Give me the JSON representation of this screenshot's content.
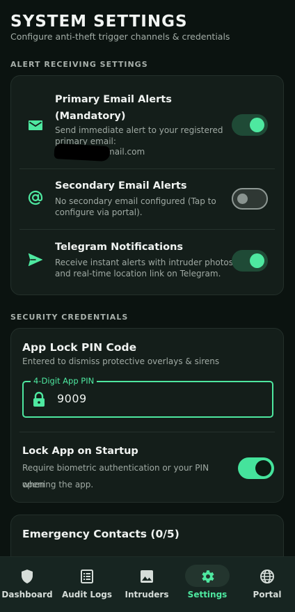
{
  "header": {
    "title": "SYSTEM SETTINGS",
    "subtitle": "Configure anti-theft trigger channels & credentials"
  },
  "alerts_section": {
    "label": "ALERT RECEIVING SETTINGS",
    "items": [
      {
        "title_line1": "Primary Email Alerts",
        "title_line2": "(Mandatory)",
        "desc_line1": "Send immediate alert to your registered",
        "desc_line2": "primary email:",
        "email_visible": "mail.com",
        "icon": "email-icon",
        "enabled": true
      },
      {
        "title": "Secondary Email Alerts",
        "desc_line1": "No secondary email configured (Tap to",
        "desc_line2": "configure via portal).",
        "icon": "at-sign-icon",
        "enabled": false
      },
      {
        "title": "Telegram Notifications",
        "desc_line1": "Receive instant alerts with intruder photos",
        "desc_line2": "and real-time location link on Telegram.",
        "icon": "send-icon",
        "enabled": true
      }
    ]
  },
  "credentials_section": {
    "label": "SECURITY CREDENTIALS",
    "pin_title": "App Lock PIN Code",
    "pin_subtitle": "Entered to dismiss protective overlays & sirens",
    "pin_field_label": "4-Digit App PIN",
    "pin_value": "9009",
    "lock_title": "Lock App on Startup",
    "lock_desc_line1": "Require biometric authentication or your PIN when",
    "lock_desc_line2": "opening the app.",
    "lock_enabled": true
  },
  "contacts_section": {
    "title": "Emergency Contacts (0/5)"
  },
  "colors": {
    "accent": "#4ee8a0",
    "background": "#0b1310",
    "card": "#141e1a"
  },
  "nav": {
    "items": [
      {
        "label": "Dashboard",
        "icon": "shield-icon"
      },
      {
        "label": "Audit Logs",
        "icon": "list-icon"
      },
      {
        "label": "Intruders",
        "icon": "image-icon"
      },
      {
        "label": "Settings",
        "icon": "gear-icon",
        "active": true
      },
      {
        "label": "Portal",
        "icon": "globe-icon"
      }
    ]
  }
}
